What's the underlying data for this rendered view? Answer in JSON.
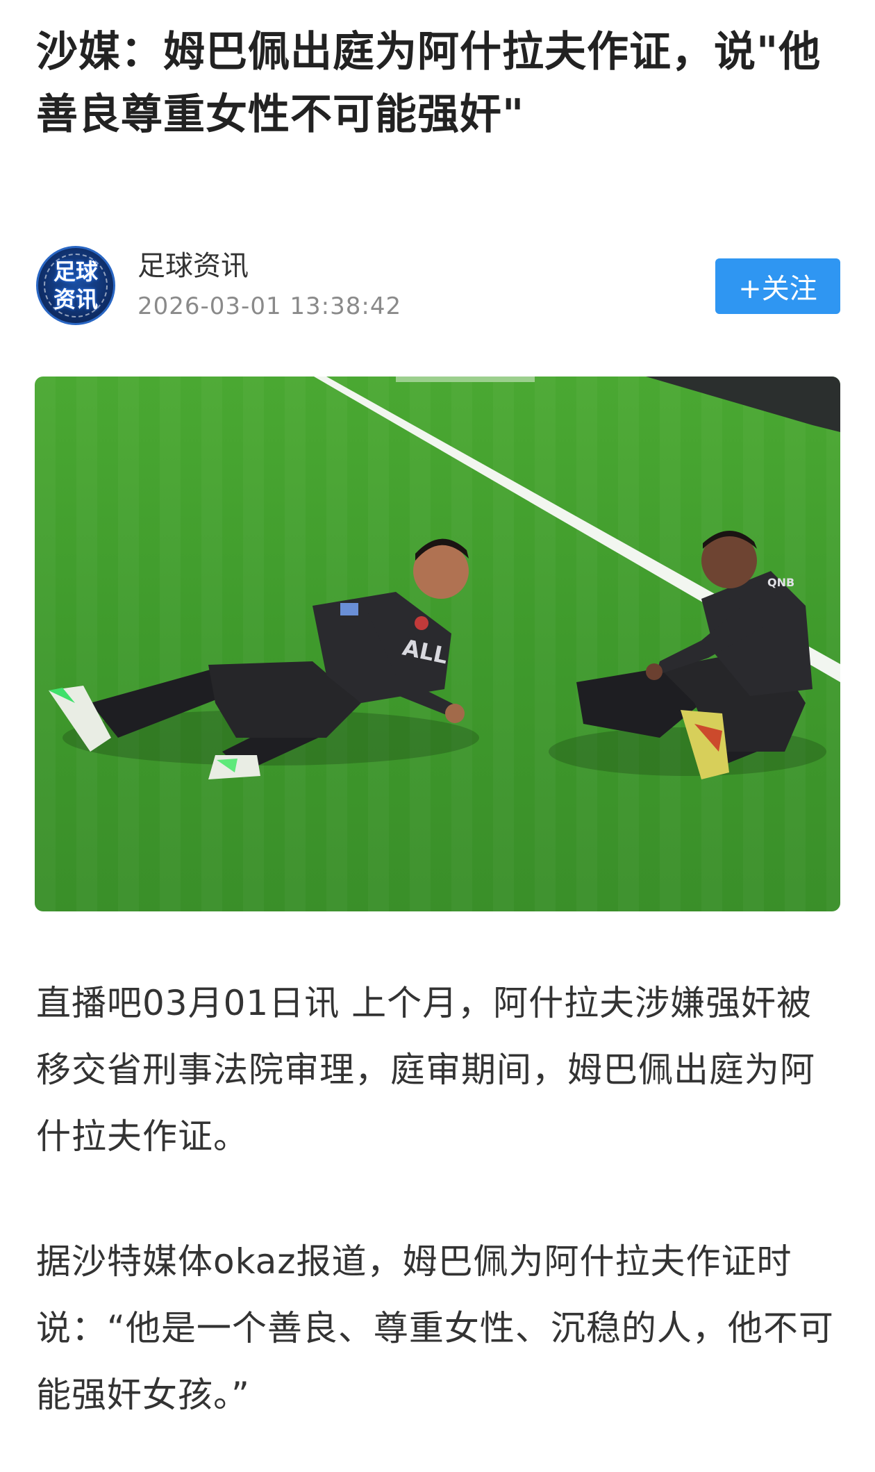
{
  "article": {
    "title": "沙媒：姆巴佩出庭为阿什拉夫作证，说\"他善良尊重女性不可能强奸\"",
    "author": {
      "name": "足球资讯",
      "avatar_text_line1": "足球",
      "avatar_text_line2": "资讯",
      "published": "2026-03-01 13:38:42"
    },
    "follow_label": "+关注",
    "image": {
      "icon": "photo-two-players-on-pitch",
      "jersey_text": "ALL"
    },
    "paragraphs": [
      "直播吧03月01日讯 上个月，阿什拉夫涉嫌强奸被移交省刑事法院审理，庭审期间，姆巴佩出庭为阿什拉夫作证。",
      "据沙特媒体okaz报道，姆巴佩为阿什拉夫作证时说：“他是一个善良、尊重女性、沉稳的人，他不可能强奸女孩。”"
    ]
  },
  "colors": {
    "accent": "#2f96f2",
    "title_text": "#222222",
    "body_text": "#333333",
    "meta_text": "#8a8a8a",
    "pitch_green": "#3f9a2c"
  }
}
